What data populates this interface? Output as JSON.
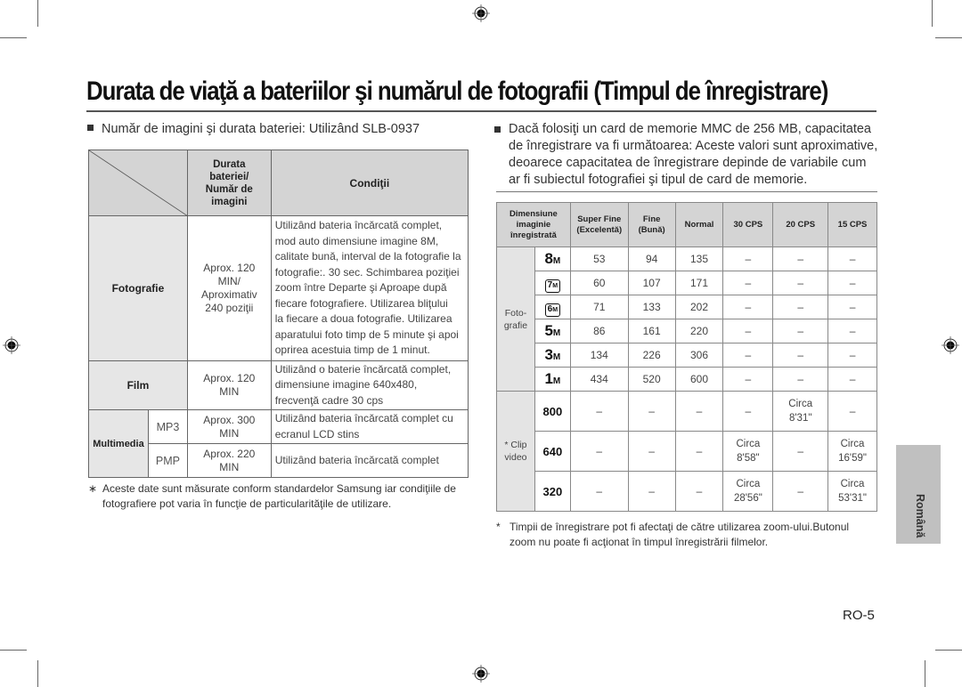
{
  "page": {
    "title": "Durata de viaţă a bateriilor şi numărul de fotografii (Timpul de înregistrare)",
    "page_number": "RO-5",
    "language_tab": "Română"
  },
  "left": {
    "heading": "Număr de imagini şi durata bateriei: Utilizând SLB-0937",
    "table": {
      "headers": {
        "duration": [
          "Durata",
          "bateriei/",
          "Număr de",
          "imagini"
        ],
        "conditions": "Condiţii"
      },
      "rows": [
        {
          "category": "Fotografie",
          "value": [
            "Aprox. 120",
            "MIN/",
            "Aproximativ",
            "240 poziţii"
          ],
          "conditions": [
            "Utilizând bateria încărcată complet,",
            "mod auto dimensiune imagine 8M,",
            "calitate bună, interval de la fotografie la",
            "fotografie:. 30 sec. Schimbarea poziţiei",
            "zoom între Departe şi Aproape după",
            "fiecare fotografiere. Utilizarea bliţului",
            "la fiecare a doua fotografie. Utilizarea",
            "aparatului foto timp de 5 minute şi apoi",
            "oprirea acestuia timp de 1 minut."
          ]
        },
        {
          "category": "Film",
          "value": [
            "Aprox. 120",
            "MIN"
          ],
          "conditions": [
            "Utilizând o baterie încărcată complet,",
            "dimensiune imagine 640x480,",
            "frecvenţă cadre 30 cps"
          ]
        },
        {
          "category": "Multimedia",
          "sub": "MP3",
          "value": [
            "Aprox. 300",
            "MIN"
          ],
          "conditions": [
            "Utilizând bateria încărcată complet cu",
            "ecranul LCD stins"
          ]
        },
        {
          "category": "Multimedia",
          "sub": "PMP",
          "value": [
            "Aprox. 220",
            "MIN"
          ],
          "conditions": [
            "Utilizând bateria încărcată complet"
          ]
        }
      ]
    },
    "footnote_mark": "∗",
    "footnote": [
      "Aceste date sunt măsurate conform standardelor Samsung iar condiţiile de",
      "fotografiere pot varia în funcţie de particularităţile de utilizare."
    ]
  },
  "right": {
    "heading": [
      "Dacă folosiţi un card de memorie MMC de 256 MB, capacitatea",
      "de înregistrare va fi următoarea: Aceste valori sunt aproximative,",
      "deoarece capacitatea de înregistrare depinde de variabile cum",
      "ar fi subiectul fotografiei şi tipul de card de memorie."
    ],
    "table": {
      "headers": {
        "size": [
          "Dimensiune",
          "imaginie",
          "înregistrată"
        ],
        "superfine": [
          "Super Fine",
          "(Excelentă)"
        ],
        "fine": [
          "Fine",
          "(Bună)"
        ],
        "normal": "Normal",
        "cps30": "30 CPS",
        "cps20": "20 CPS",
        "cps15": "15 CPS"
      },
      "photo_group": [
        "Foto-",
        "grafie"
      ],
      "photo_rows": [
        {
          "size_icon": "8M",
          "icon_name": "size-8m-icon",
          "cells": [
            "53",
            "94",
            "135",
            "–",
            "–",
            "–"
          ]
        },
        {
          "size_icon": "7M",
          "icon_name": "size-7m-wide-icon",
          "cells": [
            "60",
            "107",
            "171",
            "–",
            "–",
            "–"
          ]
        },
        {
          "size_icon": "6M",
          "icon_name": "size-6m-panorama-icon",
          "cells": [
            "71",
            "133",
            "202",
            "–",
            "–",
            "–"
          ]
        },
        {
          "size_icon": "5M",
          "icon_name": "size-5m-icon",
          "cells": [
            "86",
            "161",
            "220",
            "–",
            "–",
            "–"
          ]
        },
        {
          "size_icon": "3M",
          "icon_name": "size-3m-icon",
          "cells": [
            "134",
            "226",
            "306",
            "–",
            "–",
            "–"
          ]
        },
        {
          "size_icon": "1M",
          "icon_name": "size-1m-icon",
          "cells": [
            "434",
            "520",
            "600",
            "–",
            "–",
            "–"
          ]
        }
      ],
      "video_group": [
        "* Clip",
        "video"
      ],
      "video_rows": [
        {
          "size": "800",
          "cells": [
            "–",
            "–",
            "–",
            "–",
            "Circa|8'31\"",
            "–"
          ]
        },
        {
          "size": "640",
          "cells": [
            "–",
            "–",
            "–",
            "Circa|8'58\"",
            "–",
            "Circa|16'59\""
          ]
        },
        {
          "size": "320",
          "cells": [
            "–",
            "–",
            "–",
            "Circa|28'56\"",
            "–",
            "Circa|53'31\""
          ]
        }
      ]
    },
    "footnote_mark": "*",
    "footnote": [
      "Timpii de înregistrare pot fi afectaţi de către utilizarea zoom-ului.Butonul",
      "zoom nu poate fi acţionat în timpul înregistrării filmelor."
    ]
  }
}
